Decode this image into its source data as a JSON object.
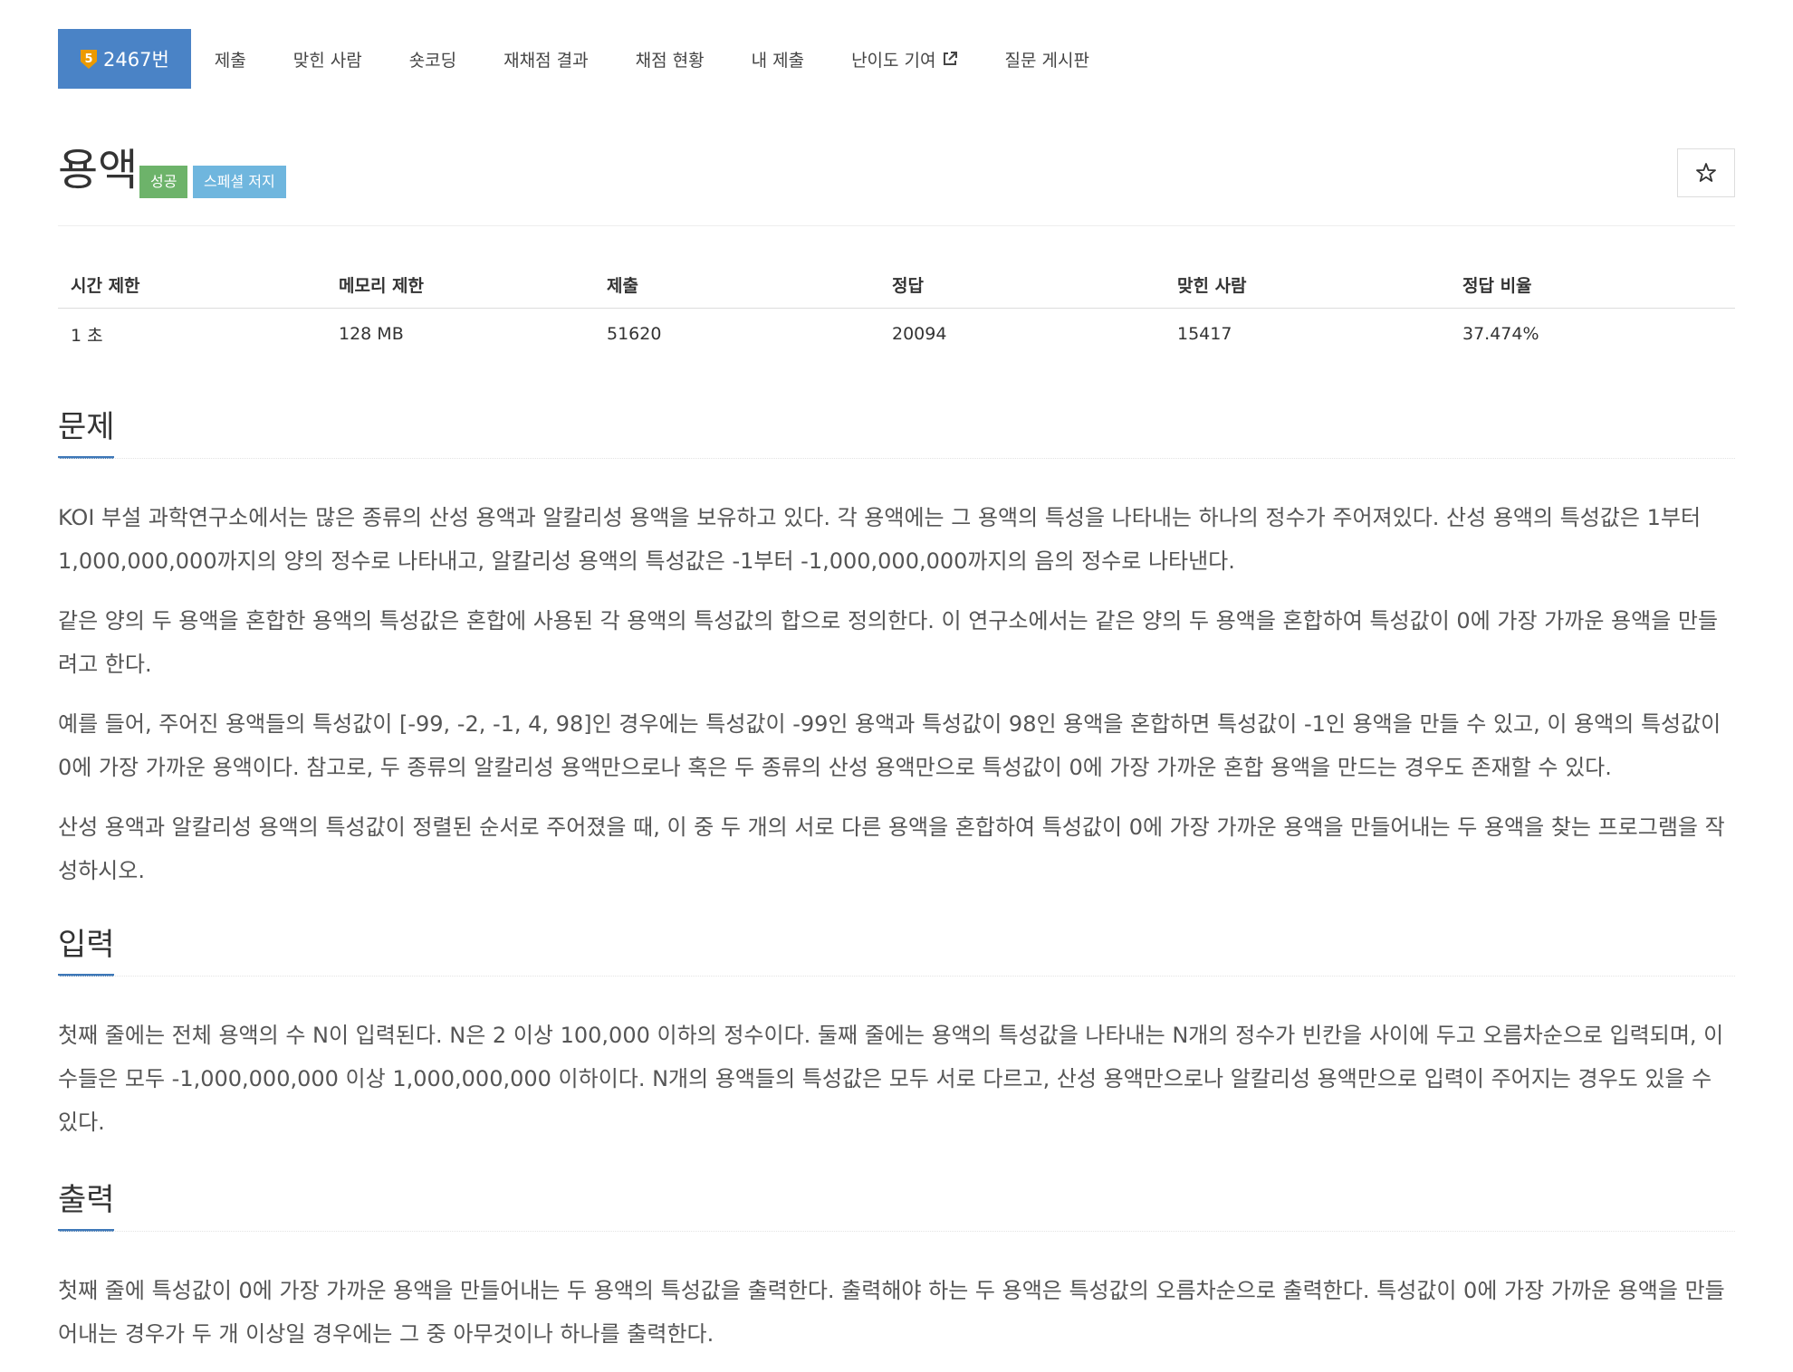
{
  "nav": {
    "problem_tab": "2467번",
    "tier_number": "5",
    "items": [
      "제출",
      "맞힌 사람",
      "숏코딩",
      "재채점 결과",
      "채점 현황",
      "내 제출",
      "난이도 기여",
      "질문 게시판"
    ]
  },
  "problem": {
    "title": "용액",
    "labels": [
      "성공",
      "스페셜 저지"
    ],
    "star": "☆"
  },
  "info": {
    "headers": [
      "시간 제한",
      "메모리 제한",
      "제출",
      "정답",
      "맞힌 사람",
      "정답 비율"
    ],
    "values": [
      "1 초",
      "128 MB",
      "51620",
      "20094",
      "15417",
      "37.474%"
    ]
  },
  "sections": {
    "description": {
      "title": "문제",
      "paragraphs": [
        "KOI 부설 과학연구소에서는 많은 종류의 산성 용액과 알칼리성 용액을 보유하고 있다. 각 용액에는 그 용액의 특성을 나타내는 하나의 정수가 주어져있다. 산성 용액의 특성값은 1부터 1,000,000,000까지의 양의 정수로 나타내고, 알칼리성 용액의 특성값은 -1부터 -1,000,000,000까지의 음의 정수로 나타낸다.",
        "같은 양의 두 용액을 혼합한 용액의 특성값은 혼합에 사용된 각 용액의 특성값의 합으로 정의한다. 이 연구소에서는 같은 양의 두 용액을 혼합하여 특성값이 0에 가장 가까운 용액을 만들려고 한다.",
        "예를 들어, 주어진 용액들의 특성값이 [-99, -2, -1, 4, 98]인 경우에는 특성값이 -99인 용액과 특성값이 98인 용액을 혼합하면 특성값이 -1인 용액을 만들 수 있고, 이 용액의 특성값이 0에 가장 가까운 용액이다. 참고로, 두 종류의 알칼리성 용액만으로나 혹은 두 종류의 산성 용액만으로 특성값이 0에 가장 가까운 혼합 용액을 만드는 경우도 존재할 수 있다.",
        "산성 용액과 알칼리성 용액의 특성값이 정렬된 순서로 주어졌을 때, 이 중 두 개의 서로 다른 용액을 혼합하여 특성값이 0에 가장 가까운 용액을 만들어내는 두 용액을 찾는 프로그램을 작성하시오."
      ]
    },
    "input": {
      "title": "입력",
      "paragraphs": [
        "첫째 줄에는 전체 용액의 수 N이 입력된다. N은 2 이상 100,000 이하의 정수이다. 둘째 줄에는 용액의 특성값을 나타내는 N개의 정수가 빈칸을 사이에 두고 오름차순으로 입력되며, 이 수들은 모두 -1,000,000,000 이상 1,000,000,000 이하이다. N개의 용액들의 특성값은 모두 서로 다르고, 산성 용액만으로나 알칼리성 용액만으로 입력이 주어지는 경우도 있을 수 있다."
      ]
    },
    "output": {
      "title": "출력",
      "paragraphs": [
        "첫째 줄에 특성값이 0에 가장 가까운 용액을 만들어내는 두 용액의 특성값을 출력한다. 출력해야 하는 두 용액은 특성값의 오름차순으로 출력한다. 특성값이 0에 가장 가까운 용액을 만들어내는 경우가 두 개 이상일 경우에는 그 중 아무것이나 하나를 출력한다."
      ]
    }
  },
  "colors": {
    "nav_active": "#4a83c6",
    "tier_gold": "#ec9a00",
    "label_success": "#6db36a",
    "label_special": "#6fb6de",
    "section_underline": "#3e78b8"
  },
  "icons": {
    "tier": "tier-gold-5-icon",
    "external": "external-link-icon",
    "star": "star-outline-icon"
  }
}
